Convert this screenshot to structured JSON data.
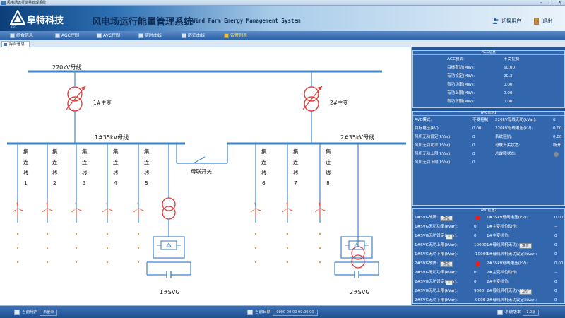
{
  "window": {
    "title": "风电场运行能量管理系统",
    "controls": "‒ ▢ ✕"
  },
  "header": {
    "logo_text": "阜特科技",
    "logo_sub": "FRT",
    "title": "风电场运行能量管理系统",
    "title_en": "Wind Farm Energy Management System",
    "switch_user": "切换用户",
    "exit": "退出"
  },
  "menu": [
    {
      "label": "综合信息"
    },
    {
      "label": "AGC控制"
    },
    {
      "label": "AVC控制"
    },
    {
      "label": "实时曲线"
    },
    {
      "label": "历史曲线"
    },
    {
      "label": "告警列表"
    }
  ],
  "tab": {
    "label": "综合信息"
  },
  "diagram": {
    "bus_220": "220kV母线",
    "transformer_1": "1#主变",
    "transformer_2": "2#主变",
    "bus_35_1": "1#35kV母线",
    "bus_35_2": "2#35kV母线",
    "tie_switch": "母联开关",
    "svg_1": "1#SVG",
    "svg_2": "2#SVG",
    "feeder_text": [
      "集",
      "连",
      "线"
    ],
    "feeders_left": [
      "1",
      "2",
      "3",
      "4",
      "5"
    ],
    "feeders_right": [
      "6",
      "7",
      "8"
    ]
  },
  "agc": {
    "title": "AGC信息",
    "rows": [
      {
        "k": "AGC模式:",
        "v": "不受控制"
      },
      {
        "k": "目标有功(MW):",
        "v": "60.00"
      },
      {
        "k": "有功设定(MW):",
        "v": "20.3"
      },
      {
        "k": "有功功率(MW):",
        "v": "0.00"
      },
      {
        "k": "有功上限(MW):",
        "v": "0.00"
      },
      {
        "k": "有功下限(MW):",
        "v": "0.00"
      }
    ]
  },
  "avc1": {
    "title": "AVC信息1",
    "left": [
      {
        "k": "AVC模式:",
        "v": "不受控制"
      },
      {
        "k": "目标电压(kV):",
        "v": "0.00"
      },
      {
        "k": "风机无功设定(kVar):",
        "v": "0"
      },
      {
        "k": "风机无功功率(kVar):",
        "v": "0"
      },
      {
        "k": "风机无功上限(kVar):",
        "v": "0"
      },
      {
        "k": "风机无功下限(kVar):",
        "v": "0"
      }
    ],
    "right": [
      {
        "k": "220kV母线无功(kVar):",
        "v": "0"
      },
      {
        "k": "220kV母线电压(kV):",
        "v": "0.00"
      },
      {
        "k": "系统阻抗:",
        "v": "0.00"
      },
      {
        "k": "母联开关状态:",
        "v": "断开"
      },
      {
        "k": "总故障状态:",
        "v": ""
      }
    ]
  },
  "avc2": {
    "title": "AVC信息2",
    "reset": "复位",
    "left": [
      {
        "k": "1#SVG故障:",
        "v": ""
      },
      {
        "k": "1#SVG无功功率(kVar):",
        "v": "0"
      },
      {
        "k": "1#SVG无功设定(kVar):",
        "v": "0"
      },
      {
        "k": "1#SVG无功上限(kVar):",
        "v": "10000"
      },
      {
        "k": "1#SVG无功下限(kVar):",
        "v": "-10000"
      },
      {
        "k": "2#SVG故障:",
        "v": ""
      },
      {
        "k": "2#SVG无功功率(kVar):",
        "v": "0"
      },
      {
        "k": "2#SVG无功设定(kVar):",
        "v": "0"
      },
      {
        "k": "2#SVG无功上限(kVar):",
        "v": "9000"
      },
      {
        "k": "2#SVG无功下限(kVar):",
        "v": "-9000"
      }
    ],
    "right": [
      {
        "k": "1#35kV母线电压(kV):",
        "v": "0.00"
      },
      {
        "k": "1#主变档位动作:",
        "v": "--"
      },
      {
        "k": "1#主变档位:",
        "v": "0"
      },
      {
        "k": "1#母线风机无功(kVar):",
        "v": "0"
      },
      {
        "k": "1#母线风机无功设定(kVar):",
        "v": "0"
      },
      {
        "k": "2#35kV母线电压(kV):",
        "v": "0.00"
      },
      {
        "k": "2#主变档位动作:",
        "v": "--"
      },
      {
        "k": "2#主变档位:",
        "v": "0"
      },
      {
        "k": "2#母线风机无功(kVar):",
        "v": "0"
      },
      {
        "k": "2#母线风机无功设定(kVar):",
        "v": "0"
      }
    ],
    "apply_mark": "↓"
  },
  "status": {
    "user_label": "当前用户",
    "user_value": "未登录",
    "date_label": "当前日期",
    "date_value": "0000-00-00 00:00:00",
    "version_label": "系统版本",
    "version_value": "1.0版"
  },
  "colors": {
    "bus": "#3f86c9",
    "turbine": "#f0572e",
    "transformer": "#e23b3b",
    "dots": "#f29a34"
  }
}
